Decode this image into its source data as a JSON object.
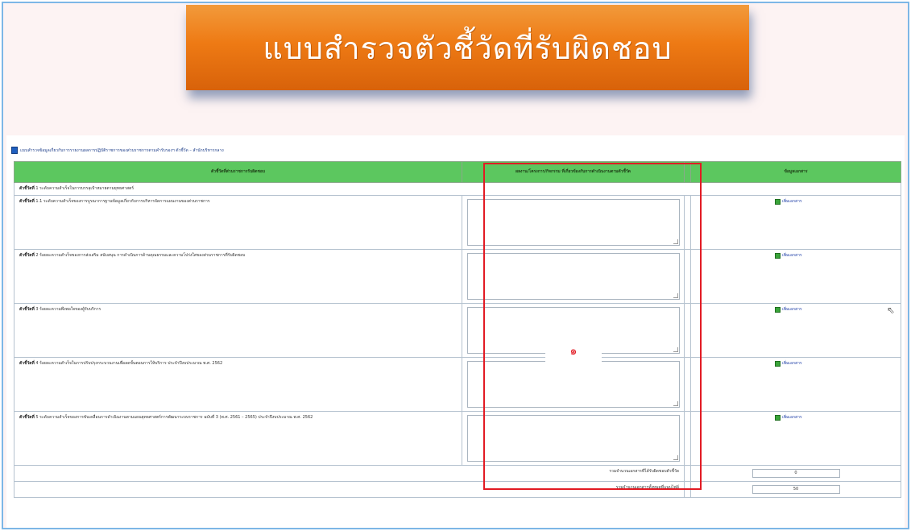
{
  "banner": {
    "title": "แบบสำรวจตัวชี้วัดที่รับผิดชอบ"
  },
  "caption": "แบบสำรวจข้อมูลเกี่ยวกับการรายงานผลการปฏิบัติราชการของส่วนราชการตามคำรับรองฯ ตัวชี้วัด – สำนักบริหารกลาง",
  "table": {
    "headers": [
      "ตัวชี้วัดที่ส่วนราชการรับผิดชอบ",
      "ผลงาน/โครงการ/กิจกรรม ที่เกี่ยวข้องกับการดำเนินงานตามตัวชี้วัด",
      "",
      "ข้อมูลเอกสาร"
    ],
    "title_row": {
      "label": "ตัวชี้วัดที่",
      "text": "1 ระดับความสำเร็จในการบรรลุเป้าหมายตามยุทธศาสตร์"
    },
    "rows": [
      {
        "label": "ตัวชี้วัดที่",
        "text": "1.1 ระดับความสำเร็จของการบูรณาการฐานข้อมูลเกี่ยวกับการบริหารจัดการแผนงานของส่วนราชการ",
        "link": "เพิ่มเอกสาร"
      },
      {
        "label": "ตัวชี้วัดที่",
        "text": "2 ร้อยละความสำเร็จของการส่งเสริม สนับสนุน การดำเนินการด้านคุณธรรมและความโปร่งใสของส่วนราชการที่รับผิดชอบ",
        "link": "เพิ่มเอกสาร"
      },
      {
        "label": "ตัวชี้วัดที่",
        "text": "3 ร้อยละความพึงพอใจของผู้รับบริการ",
        "link": "เพิ่มเอกสาร"
      },
      {
        "label": "ตัวชี้วัดที่",
        "text": "4 ร้อยละความสำเร็จในการปรับปรุงกระบวนงานเพื่อลดขั้นตอนการให้บริการ ประจำปีงบประมาณ พ.ศ. 2562",
        "link": "เพิ่มเอกสาร"
      },
      {
        "label": "ตัวชี้วัดที่",
        "text": "5 ระดับความสำเร็จของการขับเคลื่อนการดำเนินงานตามแผนยุทธศาสตร์การพัฒนาระบบราชการ ฉบับที่ 3 (พ.ศ. 2561 – 2565) ประจำปีงบประมาณ พ.ศ. 2562",
        "link": "เพิ่มเอกสาร"
      }
    ],
    "totals": [
      {
        "label": "รวมจำนวนเอกสารที่ได้รับผิดชอบตัวชี้วัด",
        "value": "0"
      },
      {
        "label": "รวมจำนวนเอกสารทั้งหมดที่แนบไฟล์",
        "value": "50"
      }
    ]
  },
  "annotation": {
    "marker": "๑",
    "color": "#e21b24"
  },
  "colors": {
    "header_green": "#5cc75f",
    "banner_orange": "#ee7a14",
    "frame_blue": "#7db7e6"
  }
}
